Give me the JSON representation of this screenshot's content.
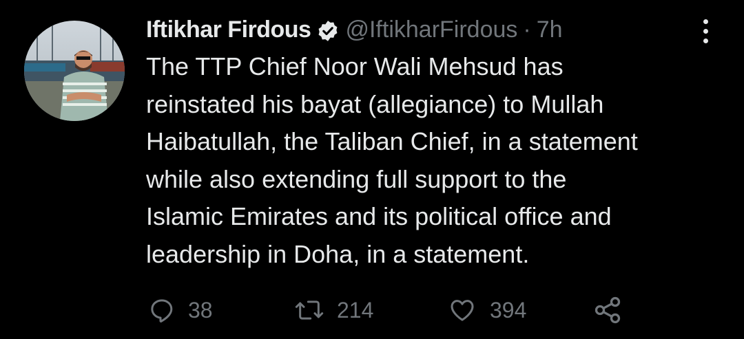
{
  "tweet": {
    "author": {
      "display_name": "Iftikhar Firdous",
      "handle": "@IftikharFirdous",
      "verified": true,
      "avatar_icon": "profile-photo"
    },
    "separator": "·",
    "time": "7h",
    "text": "The TTP Chief Noor Wali Mehsud has\nreinstated his bayat (allegiance) to Mullah\nHaibatullah, the Taliban Chief, in a statement\nwhile also extending full support to the\nIslamic Emirates and its political office and\nleadership in Doha, in a statement.",
    "actions": {
      "reply": {
        "icon": "reply-icon",
        "count": "38"
      },
      "retweet": {
        "icon": "retweet-icon",
        "count": "214"
      },
      "like": {
        "icon": "heart-icon",
        "count": "394"
      },
      "share": {
        "icon": "share-icon"
      }
    },
    "more_icon": "more-options-icon"
  },
  "colors": {
    "background": "#000000",
    "primary_text": "#e7e9ea",
    "secondary_text": "#71767b"
  }
}
